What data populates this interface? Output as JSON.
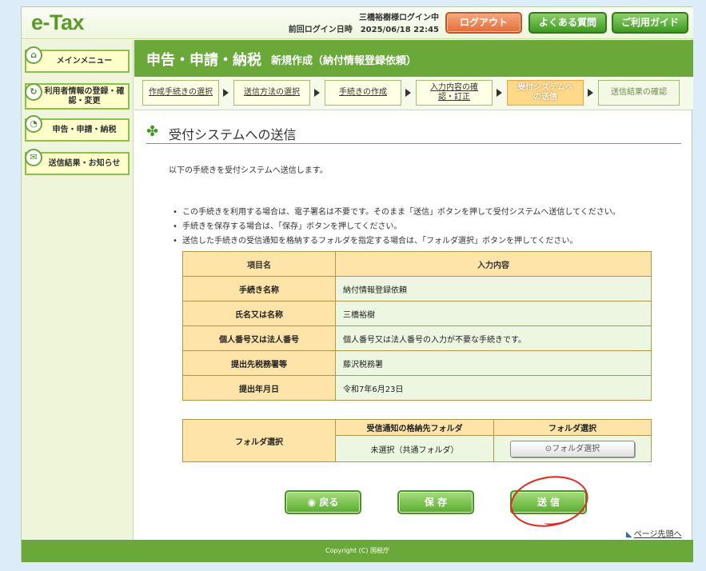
{
  "header": {
    "logo": "e-Tax",
    "user_line": "三橋裕樹様ログイン中",
    "last_login": "前回ログイン日時　2025/06/18 22:45",
    "logout_label": "ログアウト",
    "faq_label": "よくある質問",
    "guide_label": "ご利用ガイド"
  },
  "sidebar": {
    "items": [
      {
        "label": "メインメニュー",
        "icon": "home-icon"
      },
      {
        "label": "利用者情報の登録・確認・変更",
        "icon": "refresh-icon"
      },
      {
        "label": "申告・申請・納税",
        "icon": "clock-icon"
      },
      {
        "label": "送信結果・お知らせ",
        "icon": "mail-icon"
      }
    ]
  },
  "main": {
    "title": "申告・申請・納税",
    "subtitle": "新規作成（納付情報登録依頼）",
    "steps": [
      "作成手続きの選択",
      "送信方法の選択",
      "手続きの作成",
      "入力内容の確認・訂正",
      "受付システムへの送信",
      "送信結果の確認"
    ],
    "section_title": "受付システムへの送信",
    "intro": "以下の手続きを受付システムへ送信します。",
    "notes": [
      "この手続きを利用する場合は、電子署名は不要です。そのまま「送信」ボタンを押して受付システムへ送信してください。",
      "手続きを保存する場合は、「保存」ボタンを押してください。",
      "送信した手続きの受信通知を格納するフォルダを指定する場合は、「フォルダ選択」ボタンを押してください。"
    ],
    "info_table": {
      "headers": [
        "項目名",
        "入力内容"
      ],
      "rows": [
        [
          "手続き名称",
          "納付情報登録依頼"
        ],
        [
          "氏名又は名称",
          "三橋裕樹"
        ],
        [
          "個人番号又は法人番号",
          "個人番号又は法人番号の入力が不要な手続きです。"
        ],
        [
          "提出先税務署等",
          "藤沢税務署"
        ],
        [
          "提出年月日",
          "令和7年6月23日"
        ]
      ]
    },
    "folder_table": {
      "label": "フォルダ選択",
      "headers": [
        "受信通知の格納先フォルダ",
        "フォルダ選択"
      ],
      "current_folder": "未選択（共通フォルダ）",
      "button_label": "フォルダ選択"
    },
    "buttons": {
      "back": "戻る",
      "save": "保 存",
      "send": "送 信"
    },
    "page_top": "ページ先頭へ"
  },
  "footer": {
    "copyright": "Copyright (C) 国税庁"
  },
  "colors": {
    "brand_green": "#6aa83a",
    "logout_orange": "#e46c36",
    "table_header": "#ffe4aa",
    "table_value": "#ecf6e0",
    "annotation_red": "#e0281e"
  }
}
